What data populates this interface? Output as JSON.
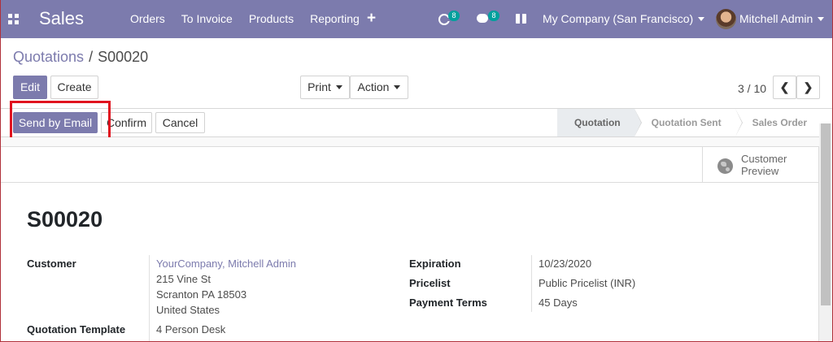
{
  "navbar": {
    "brand": "Sales",
    "menu": [
      "Orders",
      "To Invoice",
      "Products",
      "Reporting"
    ],
    "activity_count": "8",
    "messages_count": "8",
    "company": "My Company (San Francisco)",
    "user": "Mitchell Admin",
    "colors": {
      "navbar_bg": "#7c7bad",
      "badge_bg": "#00a09d"
    }
  },
  "breadcrumb": {
    "parent": "Quotations",
    "separator": "/",
    "current": "S00020"
  },
  "toolbar": {
    "edit_label": "Edit",
    "create_label": "Create",
    "print_label": "Print",
    "action_label": "Action",
    "pager": "3 / 10"
  },
  "statusbar": {
    "buttons": {
      "send_email": "Send by Email",
      "confirm": "Confirm",
      "cancel": "Cancel"
    },
    "stages": [
      "Quotation",
      "Quotation Sent",
      "Sales Order"
    ],
    "active_stage": "Quotation"
  },
  "smart_button": {
    "line1": "Customer",
    "line2": "Preview",
    "icon": "globe-icon"
  },
  "record": {
    "name": "S00020",
    "customer_label": "Customer",
    "customer_name": "YourCompany, Mitchell Admin",
    "address_line1": "215 Vine St",
    "address_line2": "Scranton PA 18503",
    "address_line3": "United States",
    "template_label": "Quotation Template",
    "template_value": "4 Person Desk",
    "expiration_label": "Expiration",
    "expiration_value": "10/23/2020",
    "pricelist_label": "Pricelist",
    "pricelist_value": "Public Pricelist (INR)",
    "terms_label": "Payment Terms",
    "terms_value": "45 Days"
  }
}
